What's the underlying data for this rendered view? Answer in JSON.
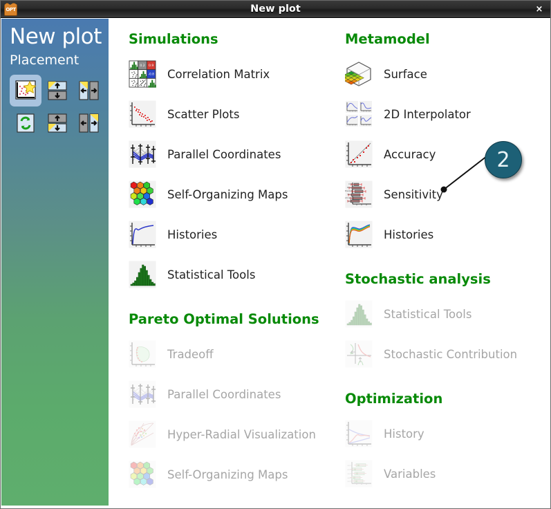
{
  "window": {
    "title": "New plot",
    "app_icon": "opt-app-icon",
    "close_label": "×"
  },
  "sidebar": {
    "title": "New plot",
    "placement_label": "Placement",
    "placement_buttons": [
      {
        "name": "placement-new-window",
        "icon": "new-plot-star-icon",
        "selected": true
      },
      {
        "name": "placement-split-below",
        "icon": "split-horizontal-top-icon",
        "selected": false
      },
      {
        "name": "placement-split-right",
        "icon": "split-vertical-left-icon",
        "selected": false
      },
      {
        "name": "placement-replace",
        "icon": "refresh-replace-icon",
        "selected": false
      },
      {
        "name": "placement-split-above",
        "icon": "split-horizontal-bottom-icon",
        "selected": false
      },
      {
        "name": "placement-split-left",
        "icon": "split-vertical-right-icon",
        "selected": false
      }
    ]
  },
  "colors": {
    "section_header": "#088a08",
    "badge": "#1d6076",
    "sidebar_top": "#4a7ab0",
    "sidebar_bottom": "#5fae6d",
    "label": "#222222",
    "label_disabled": "#a6a6a6"
  },
  "columns": {
    "left": [
      {
        "header": "Simulations",
        "items": [
          {
            "label": "Correlation Matrix",
            "icon": "correlation-matrix-icon",
            "enabled": true
          },
          {
            "label": "Scatter Plots",
            "icon": "scatter-plot-icon",
            "enabled": true
          },
          {
            "label": "Parallel Coordinates",
            "icon": "parallel-coordinates-icon",
            "enabled": true
          },
          {
            "label": "Self-Organizing Maps",
            "icon": "self-organizing-map-icon",
            "enabled": true
          },
          {
            "label": "Histories",
            "icon": "history-curve-icon",
            "enabled": true
          },
          {
            "label": "Statistical Tools",
            "icon": "histogram-icon",
            "enabled": true
          }
        ]
      },
      {
        "header": "Pareto Optimal Solutions",
        "items": [
          {
            "label": "Tradeoff",
            "icon": "tradeoff-icon",
            "enabled": false
          },
          {
            "label": "Parallel Coordinates",
            "icon": "parallel-coordinates-icon",
            "enabled": false
          },
          {
            "label": "Hyper-Radial Visualization",
            "icon": "hyper-radial-icon",
            "enabled": false
          },
          {
            "label": "Self-Organizing Maps",
            "icon": "self-organizing-map-icon",
            "enabled": false
          }
        ]
      }
    ],
    "right": [
      {
        "header": "Metamodel",
        "items": [
          {
            "label": "Surface",
            "icon": "surface-3d-icon",
            "enabled": true
          },
          {
            "label": "2D Interpolator",
            "icon": "interpolator-2d-icon",
            "enabled": true
          },
          {
            "label": "Accuracy",
            "icon": "accuracy-icon",
            "enabled": true
          },
          {
            "label": "Sensitivity",
            "icon": "sensitivity-icon",
            "enabled": true
          },
          {
            "label": "Histories",
            "icon": "history-multi-icon",
            "enabled": true
          }
        ]
      },
      {
        "header": "Stochastic analysis",
        "items": [
          {
            "label": "Statistical Tools",
            "icon": "histogram-icon",
            "enabled": false
          },
          {
            "label": "Stochastic Contribution",
            "icon": "stochastic-contribution-icon",
            "enabled": false
          }
        ]
      },
      {
        "header": "Optimization",
        "items": [
          {
            "label": "History",
            "icon": "optimization-history-icon",
            "enabled": false
          },
          {
            "label": "Variables",
            "icon": "variables-bar-icon",
            "enabled": false
          }
        ]
      }
    ]
  },
  "callout": {
    "number": "2",
    "target": "Sensitivity"
  },
  "icon_detail": {
    "correlation_matrix_cells": [
      "0.2",
      "0.9",
      "-0.8"
    ]
  }
}
